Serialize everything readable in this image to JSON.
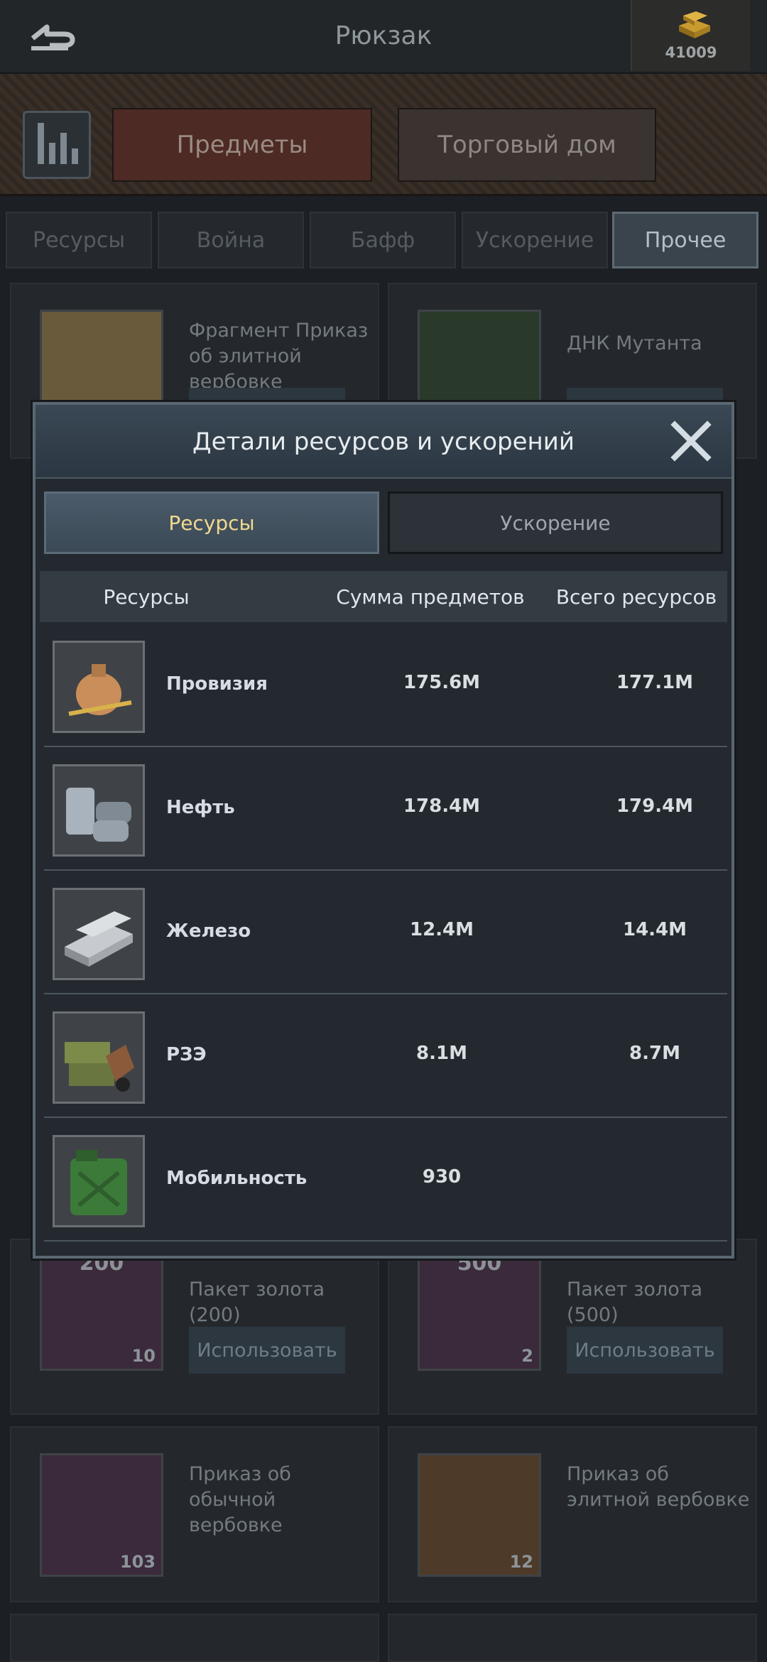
{
  "header": {
    "title": "Рюкзак",
    "gold_amount": "41009"
  },
  "main_tabs": [
    {
      "label": "Предметы"
    },
    {
      "label": "Торговый дом"
    }
  ],
  "sub_tabs": [
    {
      "label": "Ресурсы"
    },
    {
      "label": "Война"
    },
    {
      "label": "Бафф"
    },
    {
      "label": "Ускорение"
    },
    {
      "label": "Прочее"
    }
  ],
  "items": [
    {
      "name": "Фрагмент Приказ об элитной вербовке",
      "count": ""
    },
    {
      "name": "ДНК Мутанта",
      "count": ""
    },
    {
      "name": "Пакет золота (200)",
      "tag": "200",
      "count": "10",
      "button": "Использовать"
    },
    {
      "name": "Пакет золота (500)",
      "tag": "500",
      "count": "2",
      "button": "Использовать"
    },
    {
      "name": "Приказ об обычной вербовке",
      "count": "103"
    },
    {
      "name": "Приказ об элитной вербовке",
      "count": "12"
    }
  ],
  "modal": {
    "title": "Детали ресурсов и ускорений",
    "tabs": [
      {
        "label": "Ресурсы"
      },
      {
        "label": "Ускорение"
      }
    ],
    "columns": [
      "Ресурсы",
      "Сумма предметов",
      "Всего ресурсов"
    ],
    "rows": [
      {
        "name": "Провизия",
        "sum": "175.6M",
        "total": "177.1M",
        "icon": "food-sack-icon"
      },
      {
        "name": "Нефть",
        "sum": "178.4M",
        "total": "179.4M",
        "icon": "oil-barrel-icon"
      },
      {
        "name": "Железо",
        "sum": "12.4M",
        "total": "14.4M",
        "icon": "iron-ingot-icon"
      },
      {
        "name": "РЗЭ",
        "sum": "8.1M",
        "total": "8.7M",
        "icon": "rare-earth-crate-icon"
      },
      {
        "name": "Мобильность",
        "sum": "930",
        "total": "",
        "icon": "jerrycan-icon"
      }
    ]
  }
}
